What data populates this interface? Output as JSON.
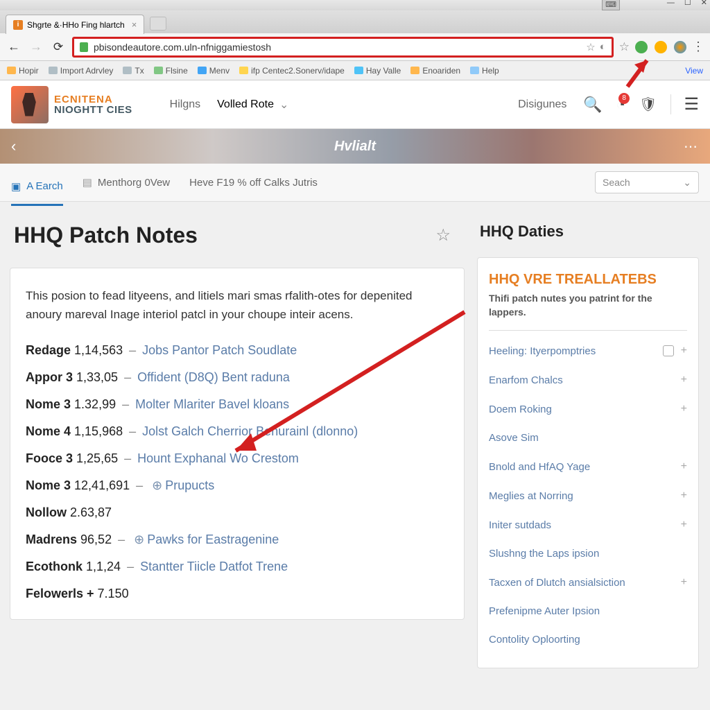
{
  "browser": {
    "tab_title": "Shgrte &·HHo Fing hlartch",
    "url": "pbisondeautore.com.uln-nfniggamiestosh",
    "bookmarks": [
      {
        "icon_color": "#ffb74d",
        "label": "Hopir"
      },
      {
        "icon_color": "#b0bec5",
        "label": "Import Adrvley"
      },
      {
        "icon_color": "#b0bec5",
        "label": "Tx"
      },
      {
        "icon_color": "#81c784",
        "label": "Flsine"
      },
      {
        "icon_color": "#42a5f5",
        "label": "Menv"
      },
      {
        "icon_color": "#ffd54f",
        "label": "ifp Centec2.Sonerv/idape"
      },
      {
        "icon_color": "#4fc3f7",
        "label": "Hay Valle"
      },
      {
        "icon_color": "#ffb74d",
        "label": "Enoariden"
      },
      {
        "icon_color": "#90caf9",
        "label": "Help"
      }
    ],
    "view_label": "View"
  },
  "site_header": {
    "logo_line1": "ECNITENA",
    "logo_line2": "NIOGHTT CIES",
    "nav1": "Hilgns",
    "nav2": "Volled Rote",
    "nav3": "Disigunes",
    "notif_count": "8"
  },
  "banner": {
    "title": "Hvlialt"
  },
  "subnav": {
    "item1": "A Earch",
    "item2": "Menthorg 0Vew",
    "item3": "Heve F19 % off Calks Jutris",
    "search_placeholder": "Seach"
  },
  "page": {
    "title": "HHQ Patch Notes",
    "intro": "This posion to fead lityeens, and litiels mari smas rfalith-otes for depenited anoury mareval Inage interiol patcl in your choupe inteir acens.",
    "patches": [
      {
        "label": "Redage",
        "num": "1,14,563",
        "link": "Jobs Pantor Patch Soudlate"
      },
      {
        "label": "Appor 3",
        "num": "1,33,05",
        "link": "Offident (D8Q) Bent raduna"
      },
      {
        "label": "Nome 3",
        "num": "1.32,99",
        "link": "Molter Mlariter Bavel kloans"
      },
      {
        "label": "Nome 4",
        "num": "1,15,968",
        "link": "Jolst Galch Cherrior Benurainl (dlonno)"
      },
      {
        "label": "Fooce 3",
        "num": "1,25,65",
        "link": "Hount Exphanal Wo Crestom"
      },
      {
        "label": "Nome 3",
        "num": "12,41,691",
        "icon": true,
        "link": "Prupucts"
      },
      {
        "label": "Nollow",
        "num": "2.63,87"
      },
      {
        "label": "Madrens",
        "num": "96,52",
        "icon": true,
        "link": "Pawks for Eastragenine"
      },
      {
        "label": "Ecothonk",
        "num": "1,1,24",
        "link": "Stantter Tiicle Datfot Trene"
      },
      {
        "label": "Felowerls +",
        "num": "7.150"
      }
    ]
  },
  "sidebar": {
    "title": "HHQ Daties",
    "heading": "HHQ VRE TREALLATEBS",
    "sub": "Thifi patch nutes you patrint for the lappers.",
    "cats": [
      {
        "label": "Heeling: Ityerpomptries",
        "badge": true,
        "plus": true
      },
      {
        "label": "Enarfom Chalcs",
        "plus": true
      },
      {
        "label": "Doem Roking",
        "plus": true
      },
      {
        "label": "Asove Sim"
      },
      {
        "label": "Bnold and HfAQ Yage",
        "plus": true
      },
      {
        "label": "Meglies at Norring",
        "plus": true
      },
      {
        "label": "Initer sutdads",
        "plus": true
      },
      {
        "label": "Slushng the Laps ipsion"
      },
      {
        "label": "Tacxen of Dlutch ansialsiction",
        "plus": true
      },
      {
        "label": "Prefenipme Auter Ipsion"
      },
      {
        "label": "Contolity Oploorting"
      }
    ]
  }
}
